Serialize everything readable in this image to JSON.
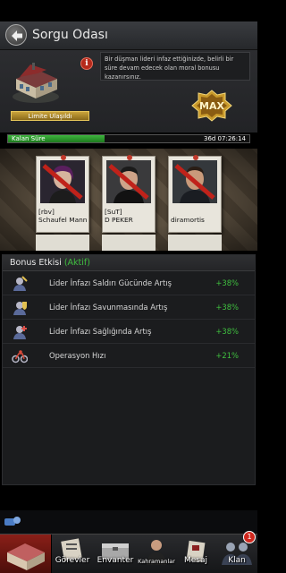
{
  "header": {
    "title": "Sorgu Odası"
  },
  "info": {
    "limit_label": "Limite Ulaşıldı",
    "description": "Bir düşman lideri infaz ettiğinizde, belirli bir süre devam edecek olan moral bonusu kazanırsınız.",
    "max_label": "MAX"
  },
  "timer": {
    "label": "Kalan Süre",
    "value": "36d 07:26:14",
    "progress": 0.4
  },
  "captives": [
    {
      "tag": "[rbv]",
      "name": "Schaufel Mann"
    },
    {
      "tag": "[SuT]",
      "name": "D PEKER"
    },
    {
      "tag": "",
      "name": "diramortis"
    }
  ],
  "bonus": {
    "title": "Bonus Etkisi",
    "status": "(Aktif)",
    "rows": [
      {
        "label": "Lider İnfazı Saldırı Gücünde Artış",
        "value": "+38%",
        "icon": "leader-attack-icon"
      },
      {
        "label": "Lider İnfazı Savunmasında Artış",
        "value": "+38%",
        "icon": "leader-defense-icon"
      },
      {
        "label": "Lider İnfazı Sağlığında Artış",
        "value": "+38%",
        "icon": "leader-health-icon"
      },
      {
        "label": "Operasyon Hızı",
        "value": "+21%",
        "icon": "operation-speed-icon"
      }
    ]
  },
  "nav": {
    "items": [
      {
        "label": "Görevler"
      },
      {
        "label": "Envanter"
      },
      {
        "label": "Kahramanlar"
      },
      {
        "label": "Mesaj"
      },
      {
        "label": "Klan",
        "badge": "1"
      }
    ]
  },
  "colors": {
    "accent_green": "#3fbf3f",
    "alert_red": "#d0281e",
    "gold": "#c9a33b"
  }
}
